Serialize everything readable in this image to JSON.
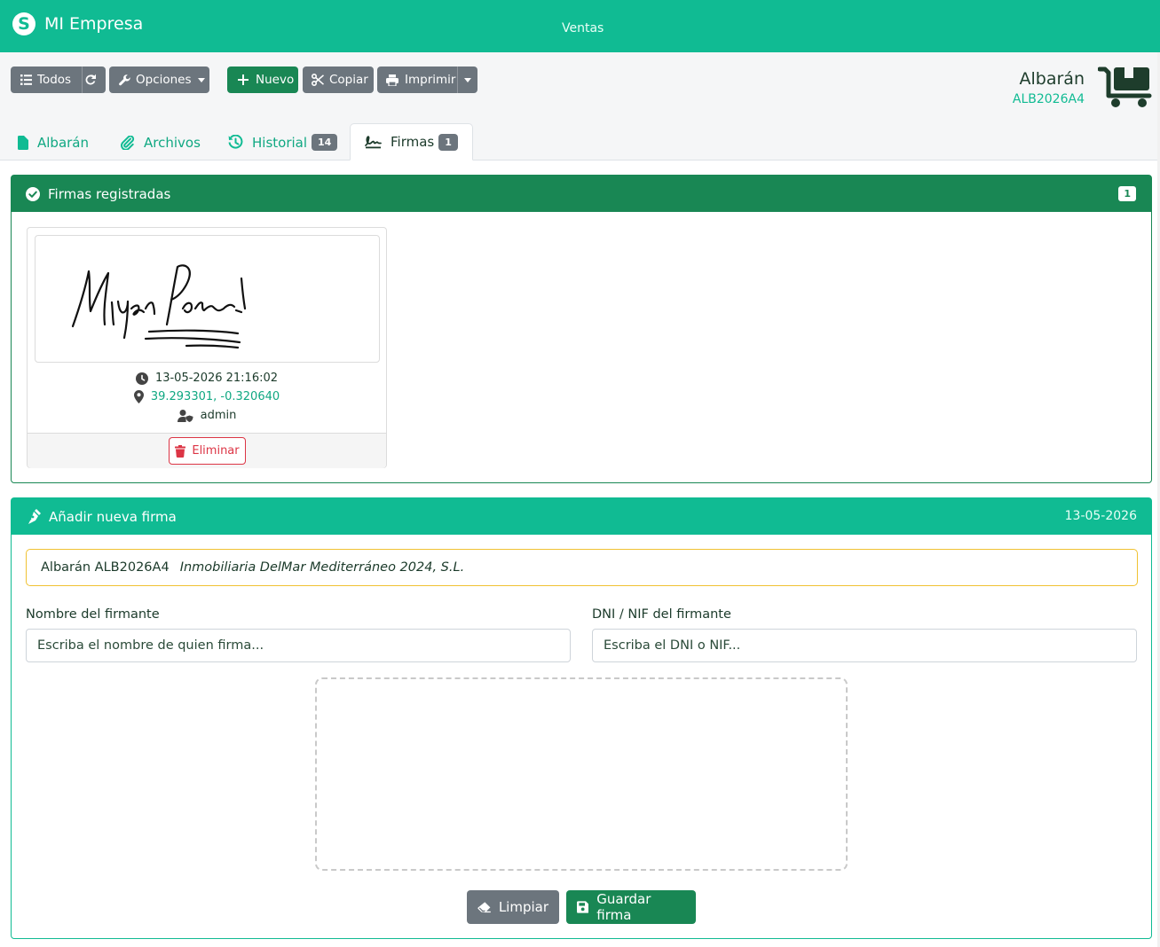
{
  "app": {
    "name": "MI Empresa",
    "nav_link": "Ventas"
  },
  "toolbar": {
    "todos_label": "Todos",
    "opciones_label": "Opciones",
    "nuevo_label": "Nuevo",
    "copiar_label": "Copiar",
    "imprimir_label": "Imprimir"
  },
  "document": {
    "type": "Albarán",
    "code": "ALB2026A4"
  },
  "tabs": [
    {
      "label": "Albarán",
      "icon": "file-icon"
    },
    {
      "label": "Archivos",
      "icon": "paperclip-icon"
    },
    {
      "label": "Historial",
      "icon": "history-icon",
      "badge": "14"
    },
    {
      "label": "Firmas",
      "icon": "signature-icon",
      "badge": "1",
      "active": true
    }
  ],
  "signatures_panel": {
    "title": "Firmas registradas",
    "count": "1",
    "signature": {
      "datetime": "13-05-2026 21:16:02",
      "coords": "39.293301, -0.320640",
      "user": "admin",
      "delete_label": "Eliminar"
    }
  },
  "new_signature_panel": {
    "title": "Añadir nueva firma",
    "date": "13-05-2026",
    "info_doc": "Albarán ALB2026A4",
    "info_client": "Inmobiliaria DelMar Mediterráneo 2024, S.L.",
    "name_label": "Nombre del firmante",
    "name_placeholder": "Escriba el nombre de quien firma...",
    "dni_label": "DNI / NIF del firmante",
    "dni_placeholder": "Escriba el DNI o NIF...",
    "clear_label": "Limpiar",
    "save_label": "Guardar firma"
  },
  "colors": {
    "primary": "#10bb93",
    "success": "#198754",
    "secondary": "#6c757d",
    "danger": "#dc3545",
    "warning_border": "#f0c232"
  }
}
